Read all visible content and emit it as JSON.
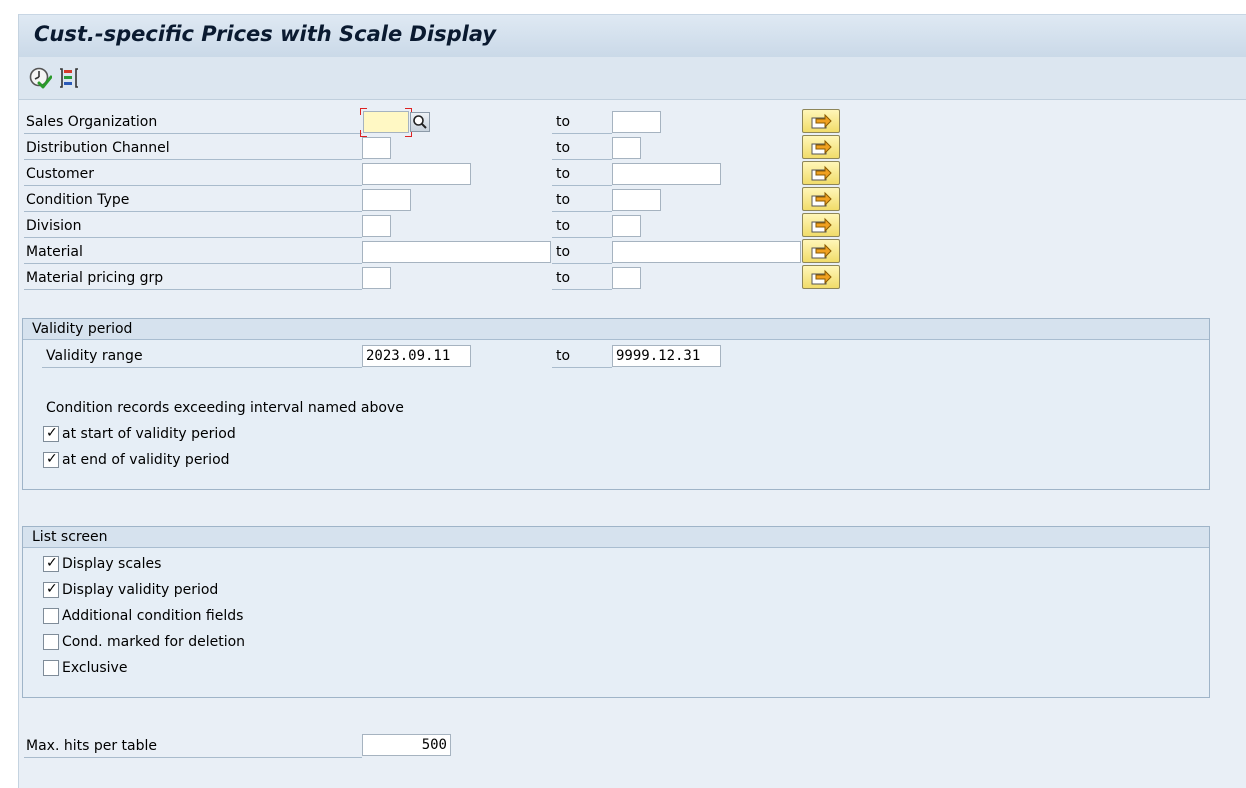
{
  "window": {
    "title": "Cust.-specific Prices with Scale Display"
  },
  "toolbar": {
    "execute_icon": "execute-clock-check-icon",
    "selection_options_icon": "selection-options-icon"
  },
  "selection": {
    "to_label": "to",
    "rows": [
      {
        "label": "Sales Organization",
        "from": "",
        "to": ""
      },
      {
        "label": "Distribution Channel",
        "from": "",
        "to": ""
      },
      {
        "label": "Customer",
        "from": "",
        "to": ""
      },
      {
        "label": "Condition Type",
        "from": "",
        "to": ""
      },
      {
        "label": "Division",
        "from": "",
        "to": ""
      },
      {
        "label": "Material",
        "from": "",
        "to": ""
      },
      {
        "label": "Material pricing grp",
        "from": "",
        "to": ""
      }
    ],
    "multiple_selection_icon": "multiple-selection-arrow-icon"
  },
  "validity": {
    "group_title": "Validity period",
    "range_label": "Validity range",
    "from": "2023.09.11",
    "to_label": "to",
    "to": "9999.12.31",
    "exceed_text": "Condition records exceeding interval named above",
    "checks": [
      {
        "label": "at start of validity period",
        "checked": true
      },
      {
        "label": "at end of validity period",
        "checked": true
      }
    ]
  },
  "list_screen": {
    "group_title": "List screen",
    "checks": [
      {
        "label": "Display scales",
        "checked": true
      },
      {
        "label": "Display validity period",
        "checked": true
      },
      {
        "label": "Additional condition fields",
        "checked": false
      },
      {
        "label": "Cond. marked for deletion",
        "checked": false
      },
      {
        "label": "Exclusive",
        "checked": false
      }
    ]
  },
  "max_hits": {
    "label": "Max. hits per table",
    "value": "500"
  },
  "colors": {
    "required_field": "#fff8c4",
    "multisel_button": "#f1dc6a",
    "group_header": "#d6e2ee"
  }
}
